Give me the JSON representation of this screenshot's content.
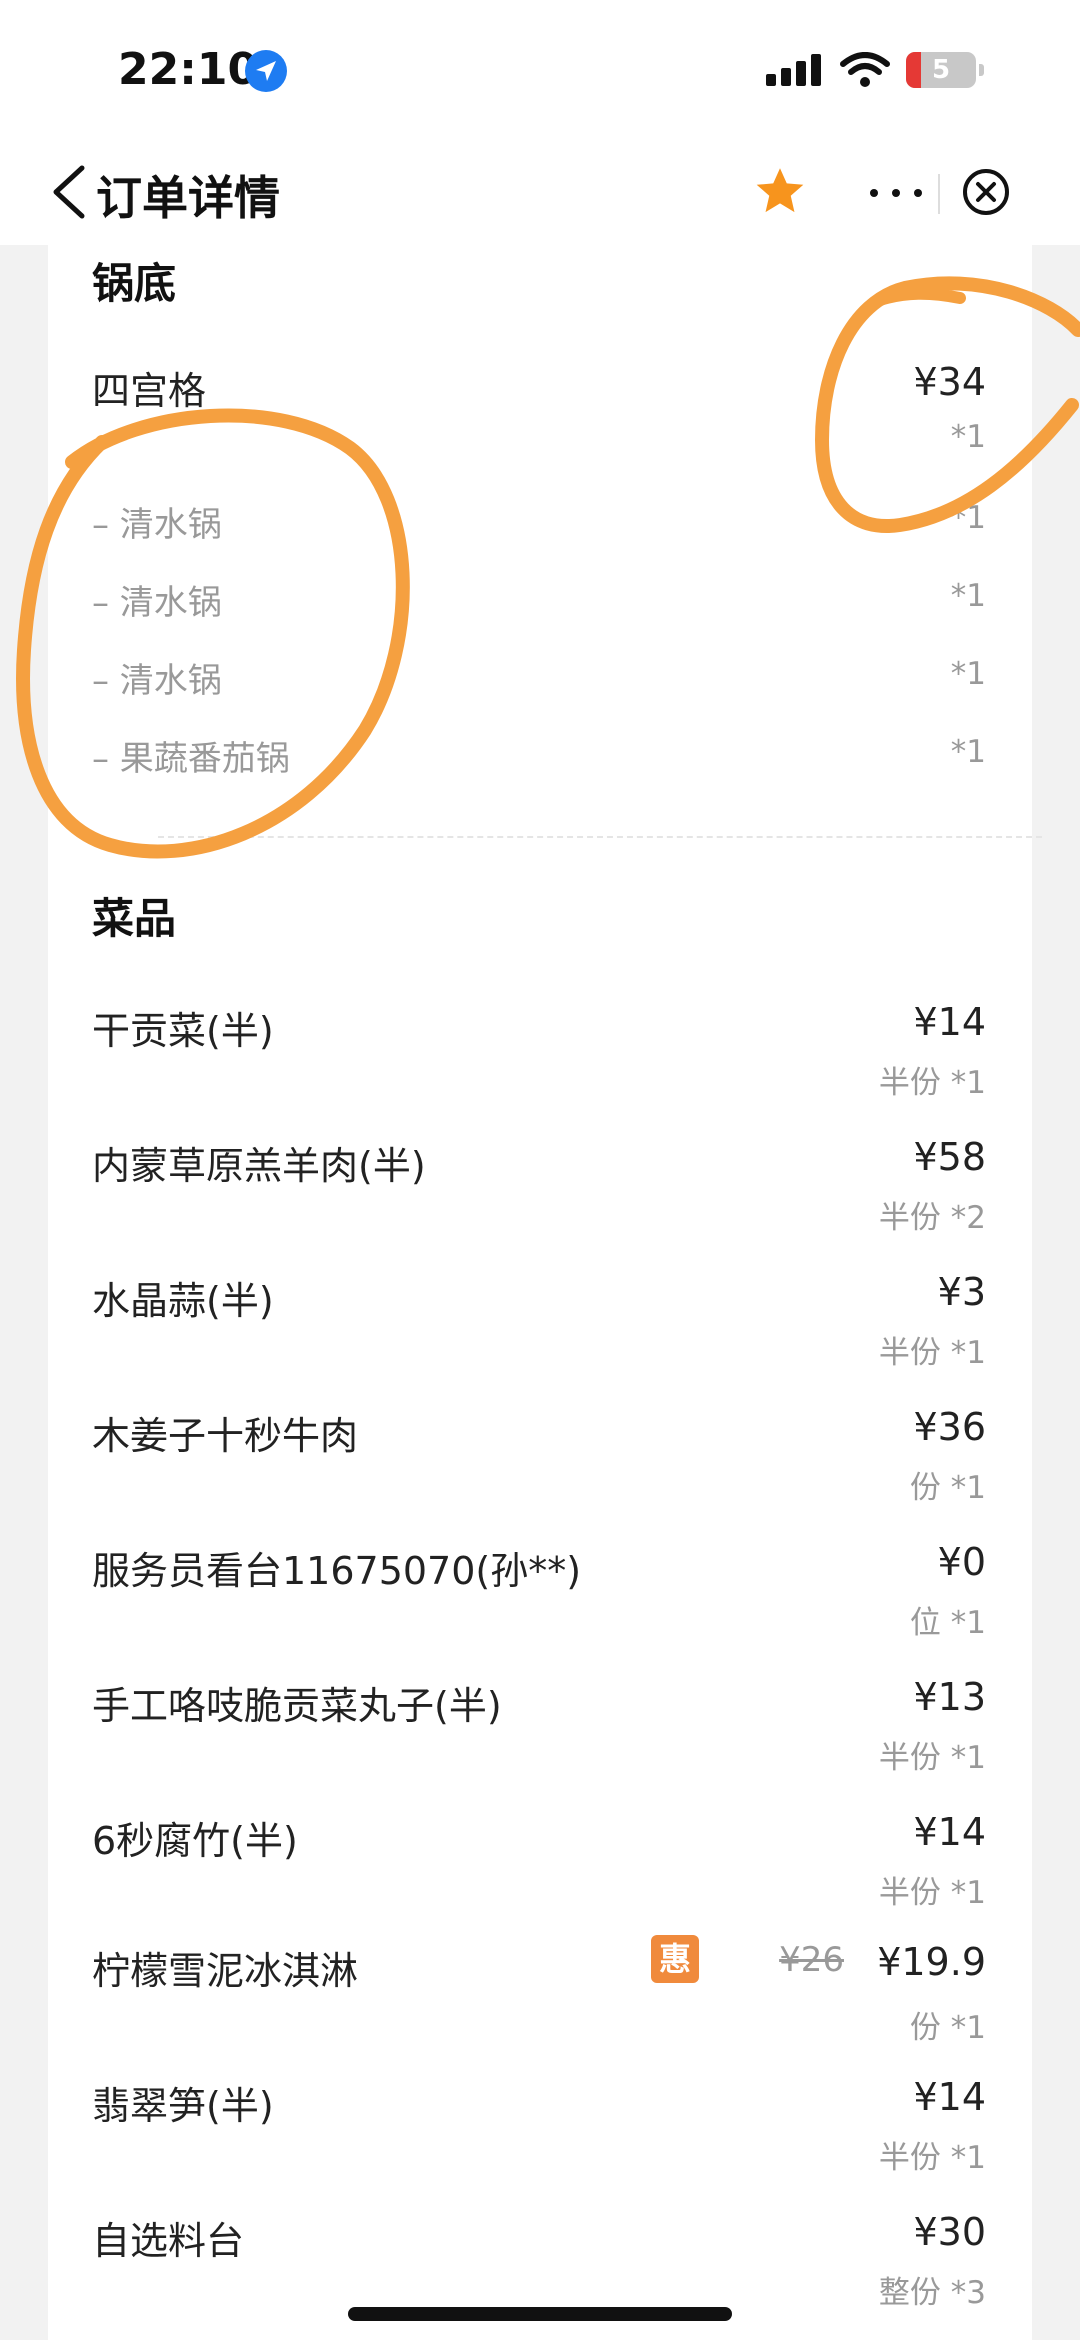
{
  "status": {
    "time": "22:10",
    "battery": "5"
  },
  "nav": {
    "title": "订单详情"
  },
  "colors": {
    "accent": "#f7941d",
    "annotation": "#f5a040",
    "badge": "#f08a3c"
  },
  "pot_section": {
    "title": "锅底",
    "item": {
      "name": "四宫格",
      "price": "¥34",
      "qty": "*1"
    },
    "subs": [
      {
        "name": "– 清水锅",
        "qty": "*1"
      },
      {
        "name": "– 清水锅",
        "qty": "*1"
      },
      {
        "name": "– 清水锅",
        "qty": "*1"
      },
      {
        "name": "– 果蔬番茄锅",
        "qty": "*1"
      }
    ]
  },
  "dish_section": {
    "title": "菜品",
    "items": [
      {
        "name": "干贡菜(半)",
        "price": "¥14",
        "qty": "半份 *1"
      },
      {
        "name": "内蒙草原羔羊肉(半)",
        "price": "¥58",
        "qty": "半份 *2"
      },
      {
        "name": "水晶蒜(半)",
        "price": "¥3",
        "qty": "半份 *1"
      },
      {
        "name": "木姜子十秒牛肉",
        "price": "¥36",
        "qty": "份 *1"
      },
      {
        "name": "服务员看台11675070(孙**)",
        "price": "¥0",
        "qty": "位 *1"
      },
      {
        "name": "手工咯吱脆贡菜丸子(半)",
        "price": "¥13",
        "qty": "半份 *1"
      },
      {
        "name": "6秒腐竹(半)",
        "price": "¥14",
        "qty": "半份 *1"
      },
      {
        "name": "柠檬雪泥冰淇淋",
        "badge": "惠",
        "original_price": "¥26",
        "price": "¥19.9",
        "qty": "份 *1"
      },
      {
        "name": "翡翠笋(半)",
        "price": "¥14",
        "qty": "半份 *1"
      },
      {
        "name": "自选料台",
        "price": "¥30",
        "qty": "整份 *3"
      }
    ]
  }
}
